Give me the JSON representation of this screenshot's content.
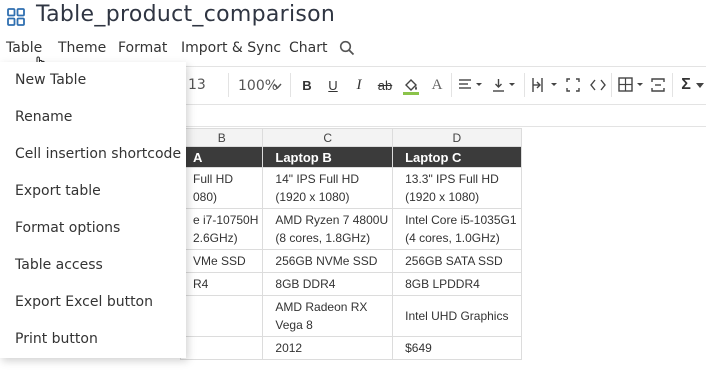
{
  "app": {
    "title": "Table_product_comparison",
    "icon": "grid-app-icon"
  },
  "menubar": {
    "items": [
      {
        "label": "Table"
      },
      {
        "label": "Theme"
      },
      {
        "label": "Format"
      },
      {
        "label": "Import & Sync"
      },
      {
        "label": "Chart"
      }
    ],
    "search_icon": "search-icon"
  },
  "table_menu": {
    "items": [
      {
        "label": "New Table"
      },
      {
        "label": "Rename"
      },
      {
        "label": "Cell insertion shortcode"
      },
      {
        "label": "Export table"
      },
      {
        "label": "Format options"
      },
      {
        "label": "Table access"
      },
      {
        "label": "Export Excel button"
      },
      {
        "label": "Print button"
      }
    ]
  },
  "toolbar": {
    "font_size": "13",
    "zoom": "100%",
    "bold": "B",
    "underline": "U",
    "italic": "I",
    "strike": "ab",
    "text_color": "A",
    "accent_color": "#8bc34a"
  },
  "sheet": {
    "columns": [
      "B",
      "C",
      "D"
    ],
    "header": [
      "A",
      "Laptop B",
      "Laptop C"
    ],
    "rows": [
      {
        "b": [
          "Full HD",
          "080)"
        ],
        "c": [
          "14\" IPS Full HD",
          "(1920 x 1080)"
        ],
        "d": [
          "13.3\" IPS Full HD",
          "(1920 x 1080)"
        ]
      },
      {
        "b": [
          "e i7-10750H",
          "2.6GHz)"
        ],
        "c": [
          "AMD Ryzen 7 4800U",
          "(8 cores, 1.8GHz)"
        ],
        "d": [
          "Intel Core i5-1035G1",
          "(4 cores, 1.0GHz)"
        ]
      },
      {
        "b": [
          "VMe SSD"
        ],
        "c": [
          "256GB NVMe SSD"
        ],
        "d": [
          "256GB SATA SSD"
        ]
      },
      {
        "b": [
          "R4"
        ],
        "c": [
          "8GB DDR4"
        ],
        "d": [
          "8GB LPDDR4"
        ]
      },
      {
        "b": [
          ""
        ],
        "c": [
          "AMD Radeon RX",
          "Vega 8"
        ],
        "d": [
          "Intel UHD Graphics"
        ]
      },
      {
        "b": [
          ""
        ],
        "c": [
          "2012"
        ],
        "d": [
          "$649"
        ]
      }
    ]
  }
}
